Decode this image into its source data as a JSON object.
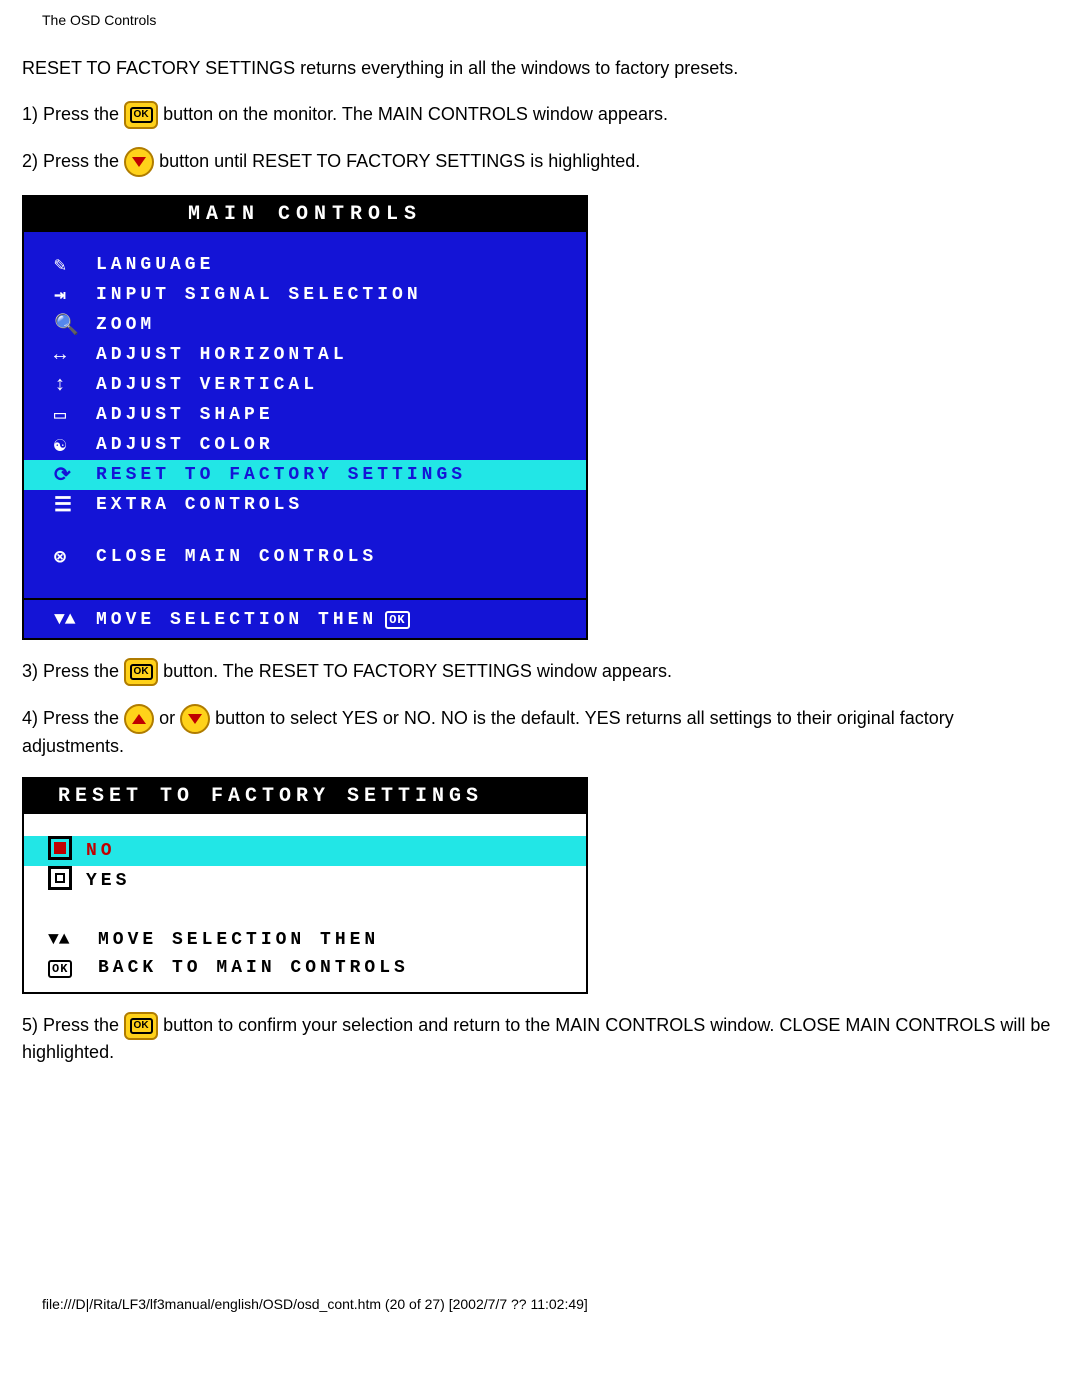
{
  "header": "The OSD Controls",
  "intro": "RESET TO FACTORY SETTINGS returns everything in all the windows to factory presets.",
  "steps": {
    "s1a": "1) Press the ",
    "s1b": " button on the monitor. The MAIN CONTROLS window appears.",
    "s2a": "2) Press the ",
    "s2b": " button until RESET TO FACTORY SETTINGS is highlighted.",
    "s3a": "3) Press the ",
    "s3b": " button. The RESET TO FACTORY SETTINGS window appears.",
    "s4a": "4) Press the ",
    "s4b": " or ",
    "s4c": " button to select YES or NO. NO is the default. YES returns all settings to their original factory adjustments.",
    "s5a": "5) Press the ",
    "s5b": " button to confirm your selection and return to the MAIN CONTROLS window. CLOSE MAIN CONTROLS will be highlighted."
  },
  "osd1": {
    "title": "MAIN CONTROLS",
    "items": [
      "LANGUAGE",
      "INPUT SIGNAL SELECTION",
      "ZOOM",
      "ADJUST HORIZONTAL",
      "ADJUST VERTICAL",
      "ADJUST SHAPE",
      "ADJUST COLOR",
      "RESET TO FACTORY SETTINGS",
      "EXTRA CONTROLS"
    ],
    "highlighted_index": 7,
    "close": "CLOSE MAIN CONTROLS",
    "footer": "MOVE SELECTION THEN",
    "ok": "OK"
  },
  "osd2": {
    "title": "RESET TO FACTORY SETTINGS",
    "options": [
      "NO",
      "YES"
    ],
    "highlighted_index": 0,
    "footer_line1": "MOVE SELECTION THEN",
    "footer_line2": "BACK TO MAIN CONTROLS",
    "ok": "OK"
  },
  "footer_path": "file:///D|/Rita/LF3/lf3manual/english/OSD/osd_cont.htm (20 of 27) [2002/7/7 ?? 11:02:49]"
}
